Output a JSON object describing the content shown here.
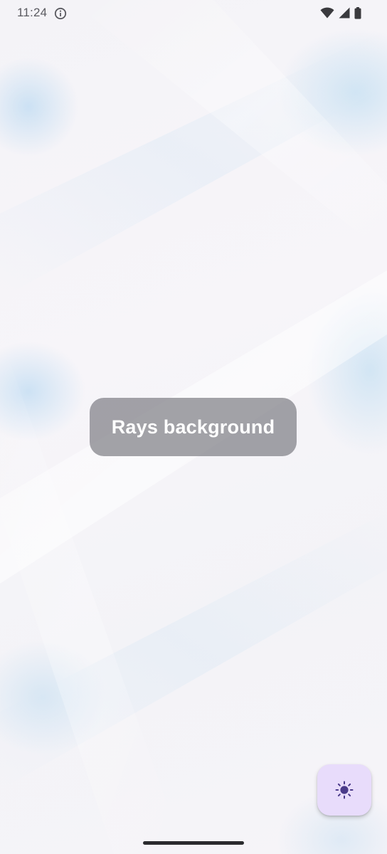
{
  "status_bar": {
    "time": "11:24",
    "icons": [
      "info-icon",
      "wifi-icon",
      "cellular-signal-icon",
      "battery-icon"
    ]
  },
  "toast": {
    "message": "Rays background"
  },
  "fab": {
    "icon": "brightness-icon",
    "background_color": "#e8dcfb",
    "icon_color": "#4a3a8a"
  },
  "colors": {
    "background": "#f6f4f8",
    "ray_tint": "#b4d8f0"
  }
}
